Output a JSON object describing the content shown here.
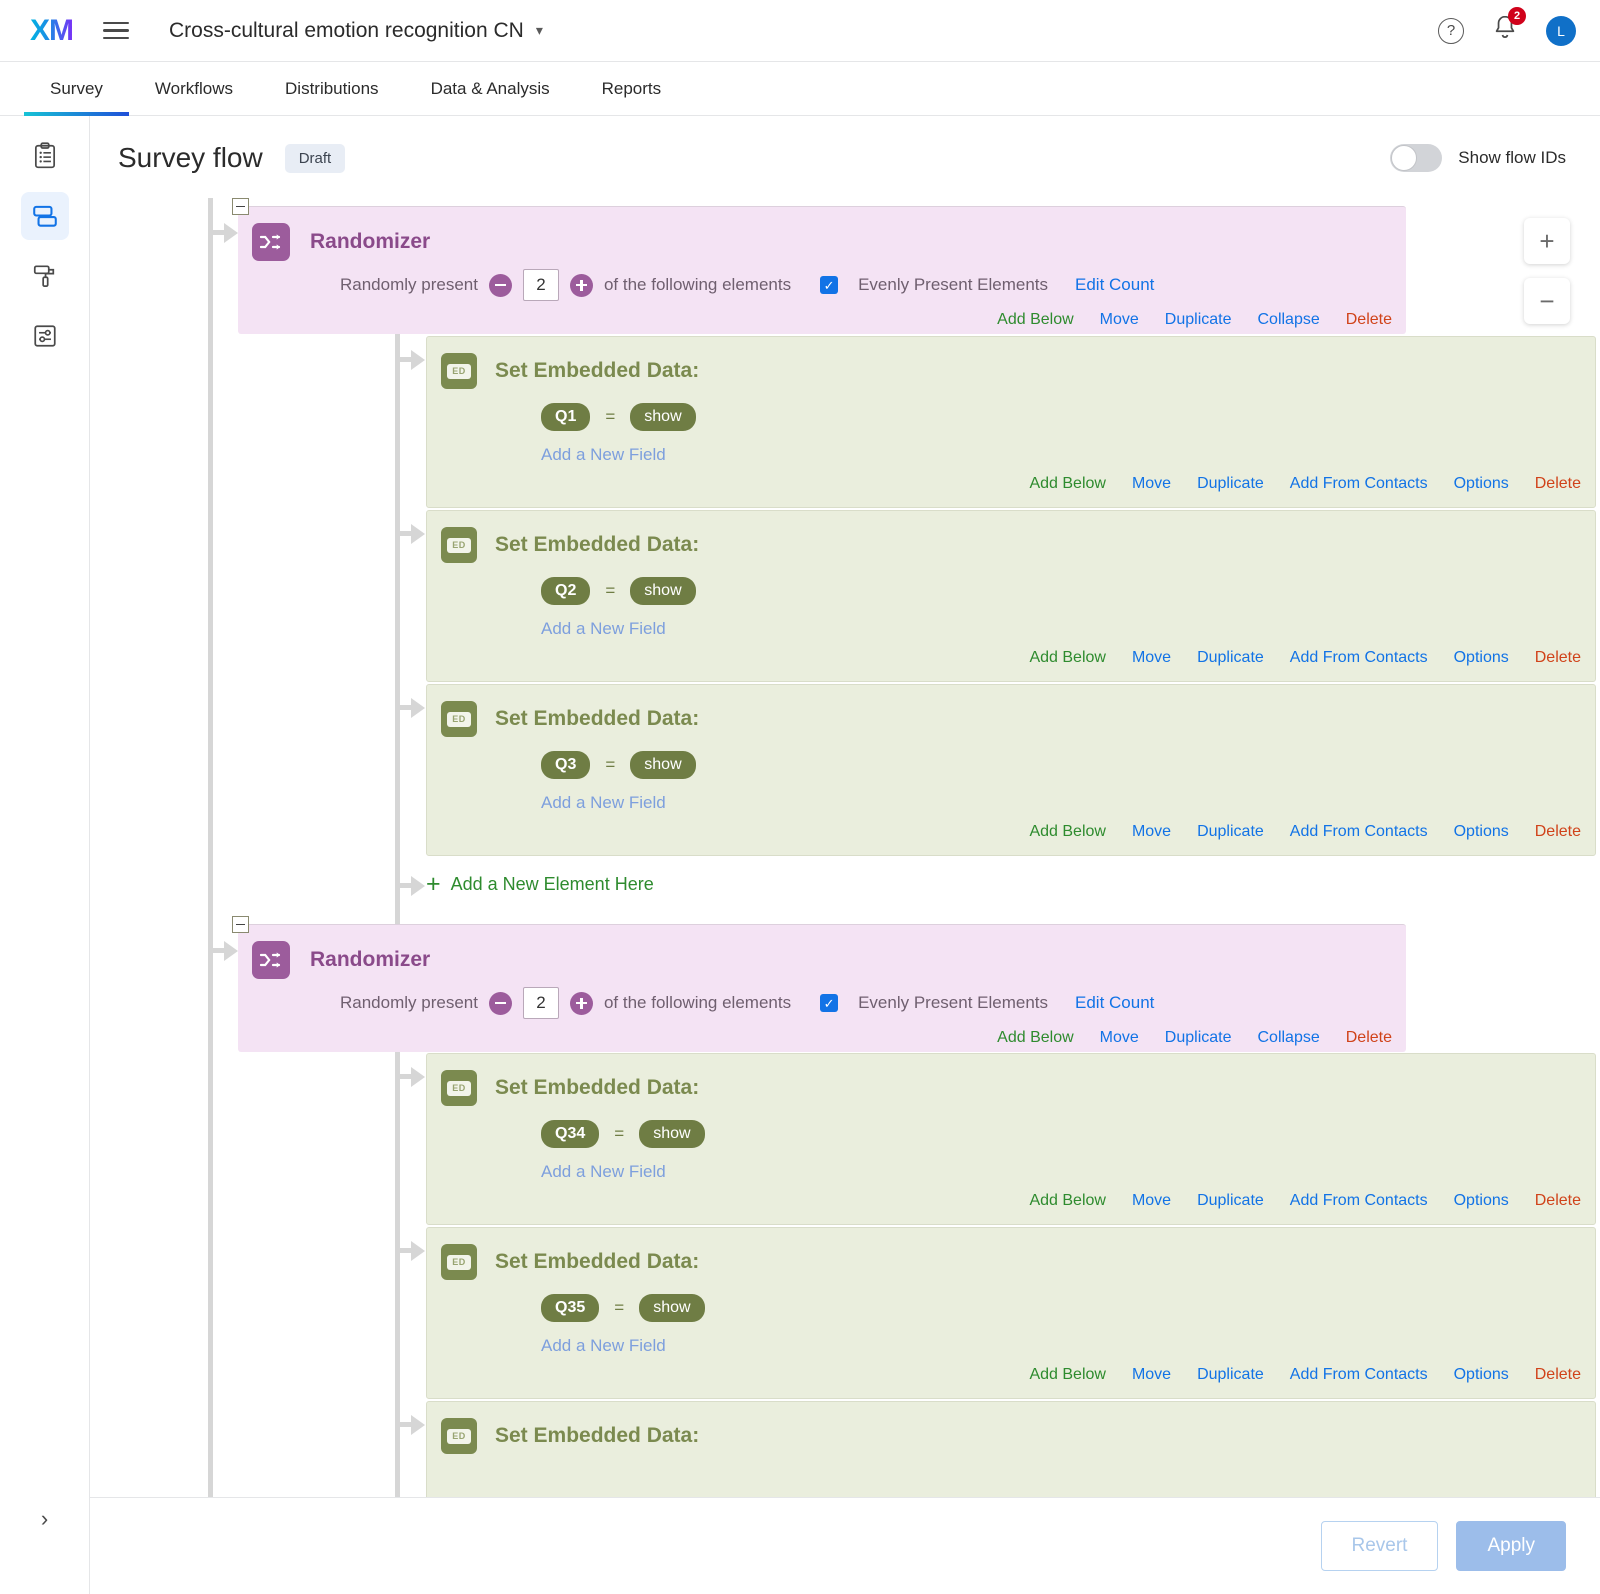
{
  "topbar": {
    "logo": "XM",
    "menu_icon": "hamburger-icon",
    "project_title": "Cross-cultural emotion recognition CN",
    "chevron": "⌄",
    "help_icon": "?",
    "notification_count": "2",
    "avatar_initial": "L"
  },
  "tabs": [
    {
      "label": "Survey",
      "active": true
    },
    {
      "label": "Workflows",
      "active": false
    },
    {
      "label": "Distributions",
      "active": false
    },
    {
      "label": "Data & Analysis",
      "active": false
    },
    {
      "label": "Reports",
      "active": false
    }
  ],
  "leftrail": {
    "items": [
      {
        "name": "survey-builder-icon",
        "active": false
      },
      {
        "name": "survey-flow-icon",
        "active": true
      },
      {
        "name": "look-and-feel-icon",
        "active": false
      },
      {
        "name": "survey-options-icon",
        "active": false
      }
    ],
    "expand_chevron": "›"
  },
  "page": {
    "title": "Survey flow",
    "status_chip": "Draft",
    "flow_ids_label": "Show flow IDs",
    "flow_ids_on": false
  },
  "zoom_controls": {
    "zoom_in": "+",
    "zoom_out": "−"
  },
  "randomizer_labels": {
    "title": "Randomizer",
    "prefix": "Randomly present",
    "suffix": "of the following elements",
    "evenly": "Evenly Present Elements",
    "edit_count": "Edit Count",
    "decrement": "−",
    "increment": "+",
    "check": "✓"
  },
  "embedded_labels": {
    "title": "Set Embedded Data:",
    "icon_text": "ED",
    "equals": "=",
    "add_field": "Add a New Field"
  },
  "actions_randomizer": {
    "add_below": "Add Below",
    "move": "Move",
    "duplicate": "Duplicate",
    "collapse": "Collapse",
    "delete": "Delete"
  },
  "actions_embedded": {
    "add_below": "Add Below",
    "move": "Move",
    "duplicate": "Duplicate",
    "add_from_contacts": "Add From Contacts",
    "options": "Options",
    "delete": "Delete"
  },
  "add_element_label": "Add a New Element Here",
  "flow": {
    "randomizer_1": {
      "count": "2",
      "evenly_checked": true
    },
    "randomizer_2": {
      "count": "2",
      "evenly_checked": true
    },
    "ed_1": {
      "field": "Q1",
      "value": "show"
    },
    "ed_2": {
      "field": "Q2",
      "value": "show"
    },
    "ed_3": {
      "field": "Q3",
      "value": "show"
    },
    "ed_4": {
      "field": "Q34",
      "value": "show"
    },
    "ed_5": {
      "field": "Q35",
      "value": "show"
    },
    "ed_6": {
      "field": "",
      "value": ""
    }
  },
  "footer": {
    "revert": "Revert",
    "apply": "Apply"
  },
  "colors": {
    "accent_blue": "#1273e6",
    "randomizer_purple": "#9c5c9c",
    "embedded_green": "#7b8a4f",
    "delete_red": "#d0431a",
    "add_green": "#2e8b2e"
  }
}
